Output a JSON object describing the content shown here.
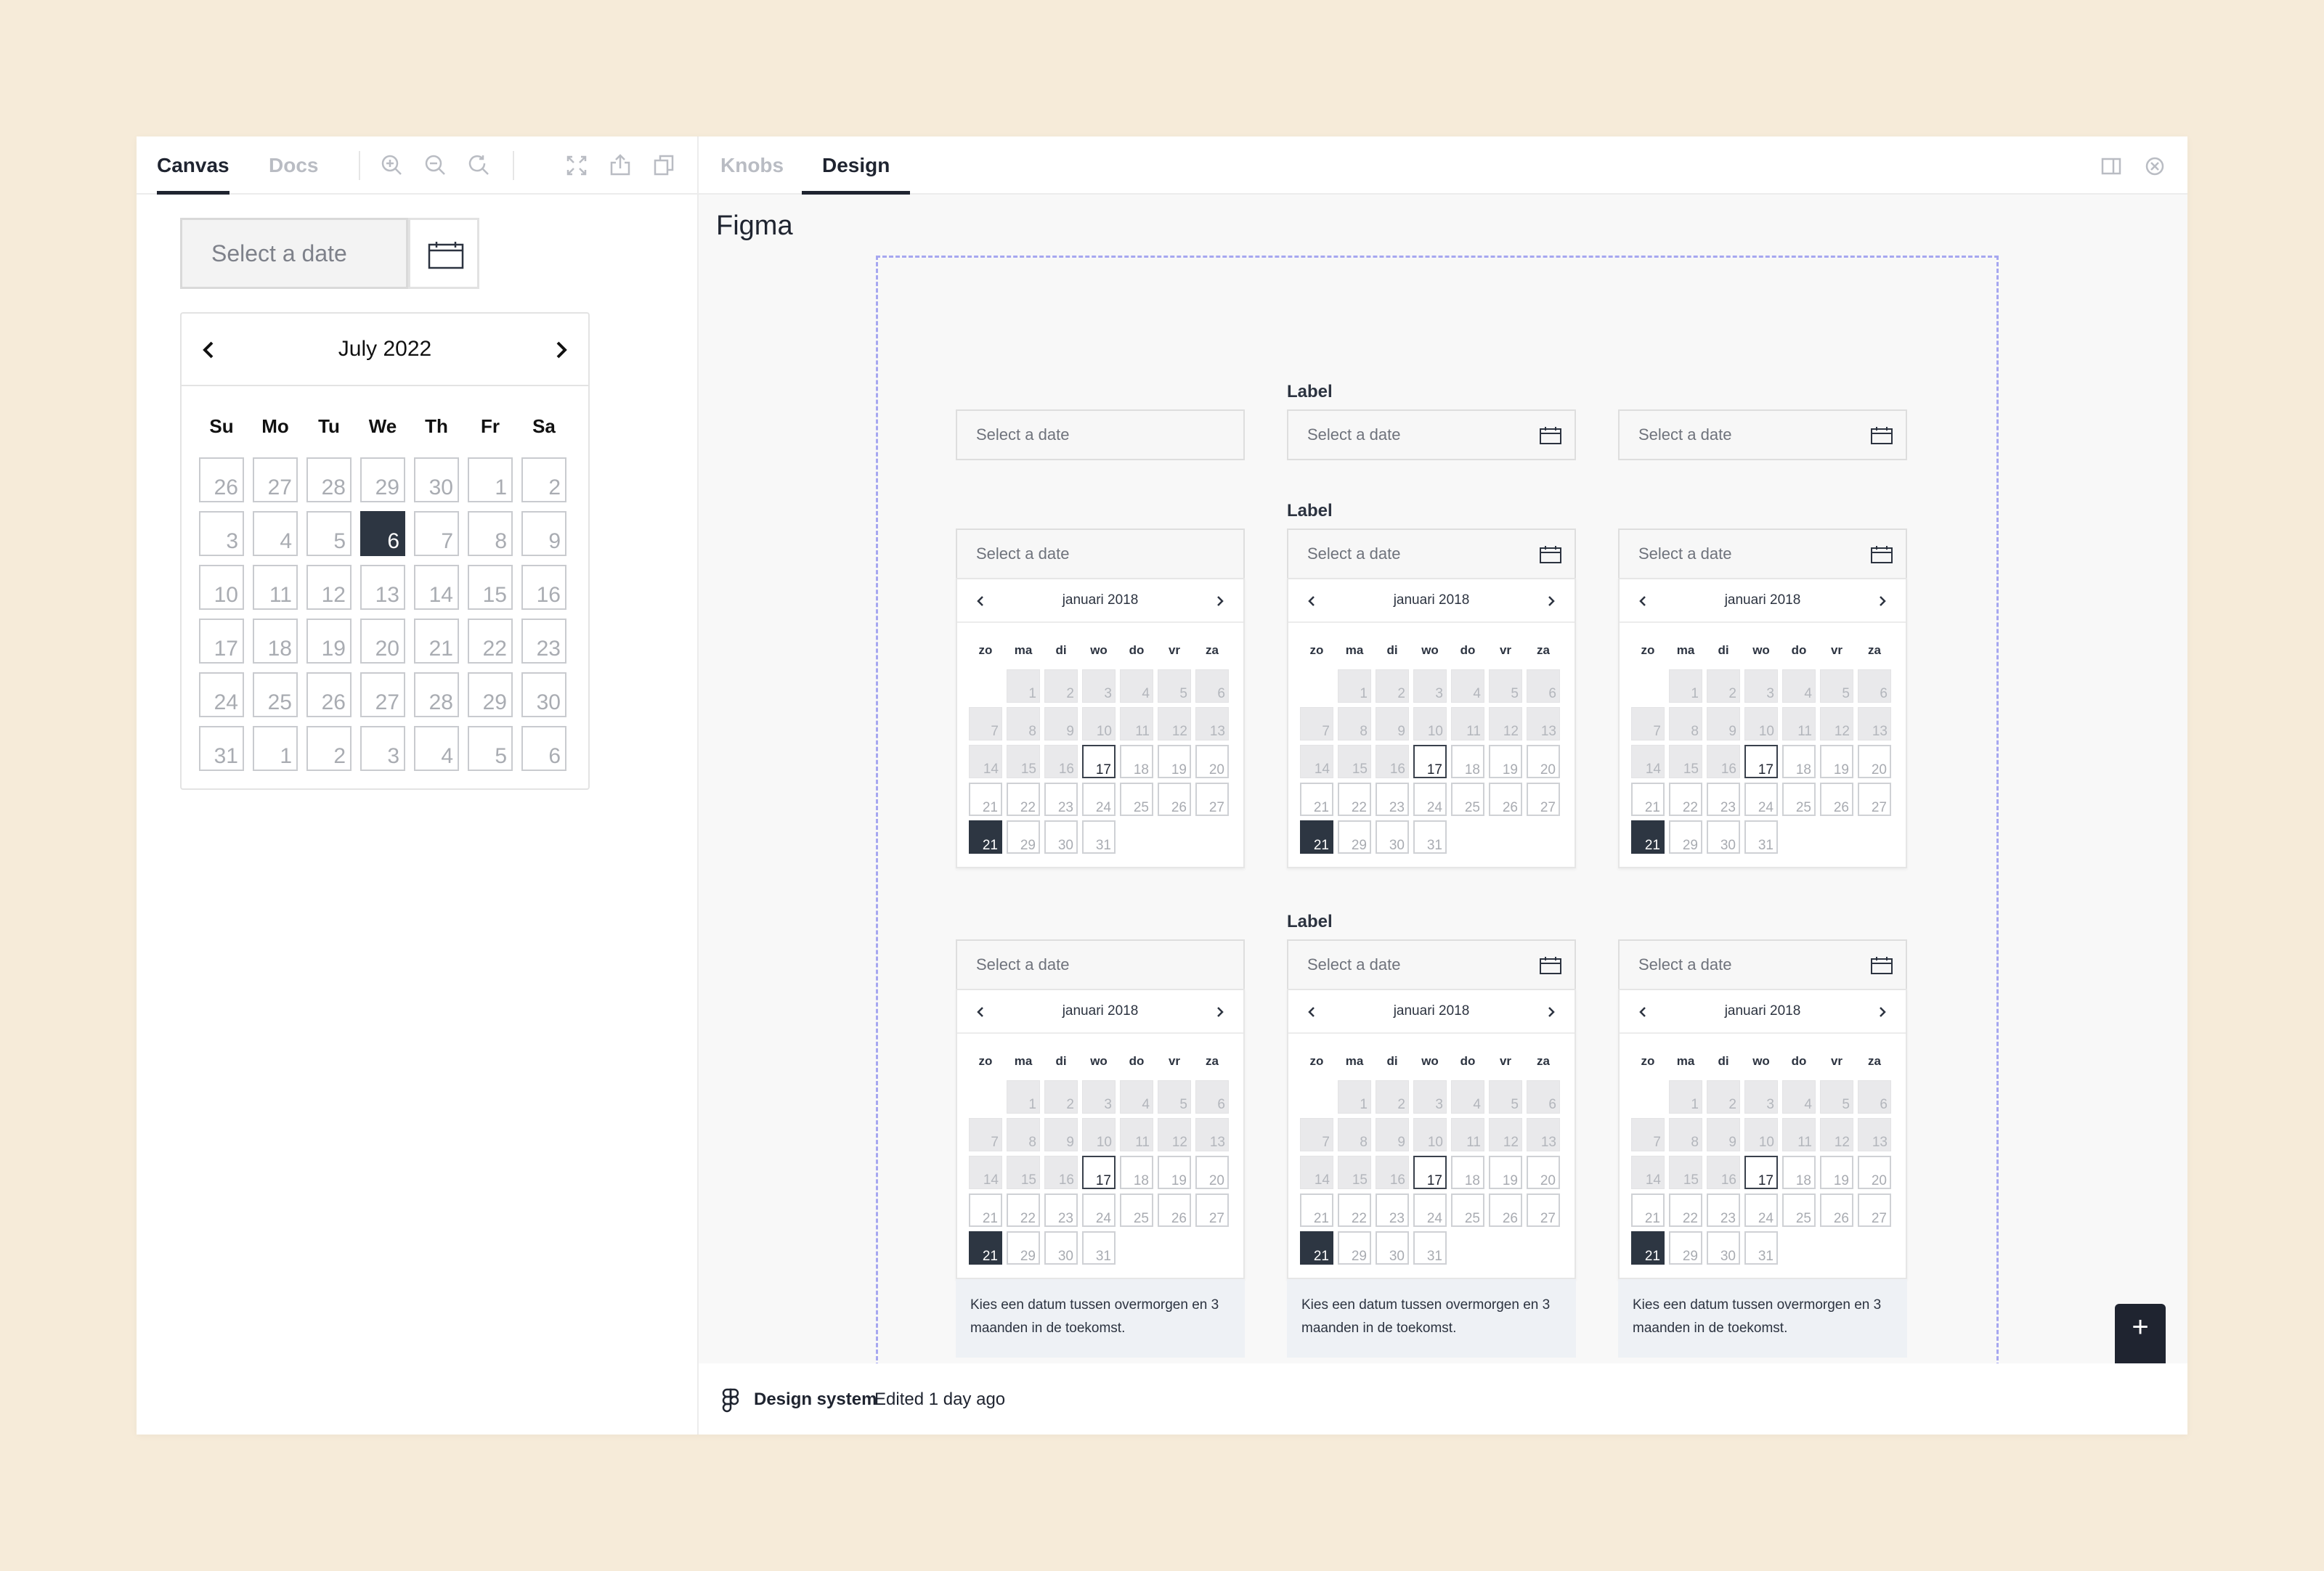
{
  "left": {
    "tabs": {
      "canvas": "Canvas",
      "docs": "Docs"
    },
    "toolbar_icons": [
      "zoom-in-icon",
      "zoom-out-icon",
      "reset-zoom-icon",
      "fullscreen-icon",
      "share-icon",
      "copy-icon"
    ],
    "input_placeholder": "Select a date",
    "calendar": {
      "month": "July 2022",
      "weekdays": [
        "Su",
        "Mo",
        "Tu",
        "We",
        "Th",
        "Fr",
        "Sa"
      ],
      "weeks": [
        [
          "26",
          "27",
          "28",
          "29",
          "30",
          "1",
          "2"
        ],
        [
          "3",
          "4",
          "5",
          "6",
          "7",
          "8",
          "9"
        ],
        [
          "10",
          "11",
          "12",
          "13",
          "14",
          "15",
          "16"
        ],
        [
          "17",
          "18",
          "19",
          "20",
          "21",
          "22",
          "23"
        ],
        [
          "24",
          "25",
          "26",
          "27",
          "28",
          "29",
          "30"
        ],
        [
          "31",
          "1",
          "2",
          "3",
          "4",
          "5",
          "6"
        ]
      ],
      "selected_day": "6"
    }
  },
  "right": {
    "tabs": {
      "knobs": "Knobs",
      "design": "Design"
    },
    "toolbar_icons": [
      "sidebar-toggle-icon",
      "close-icon"
    ],
    "figma_title": "Figma",
    "label": "Label",
    "placeholder": "Select a date",
    "mini_calendar": {
      "month": "januari 2018",
      "weekdays": [
        "zo",
        "ma",
        "di",
        "wo",
        "do",
        "vr",
        "za"
      ],
      "weeks": [
        [
          "",
          "1",
          "2",
          "3",
          "4",
          "5",
          "6"
        ],
        [
          "7",
          "8",
          "9",
          "10",
          "11",
          "12",
          "13"
        ],
        [
          "14",
          "15",
          "16",
          "17",
          "18",
          "19",
          "20"
        ],
        [
          "21",
          "22",
          "23",
          "24",
          "25",
          "26",
          "27"
        ],
        [
          "21",
          "29",
          "30",
          "31",
          "",
          "",
          ""
        ]
      ],
      "today_day": "17",
      "selected_day": "21"
    },
    "hint_text": "Kies een datum tussen overmorgen en 3 maanden in de toekomst.",
    "zoom": {
      "in": "+",
      "out": "–"
    },
    "footer": {
      "file_name": "Design system",
      "edited": "Edited 1 day ago"
    }
  },
  "colors": {
    "background": "#f6ebd9",
    "selected_day": "#2d3642",
    "frame_border": "#a6a7f0"
  }
}
